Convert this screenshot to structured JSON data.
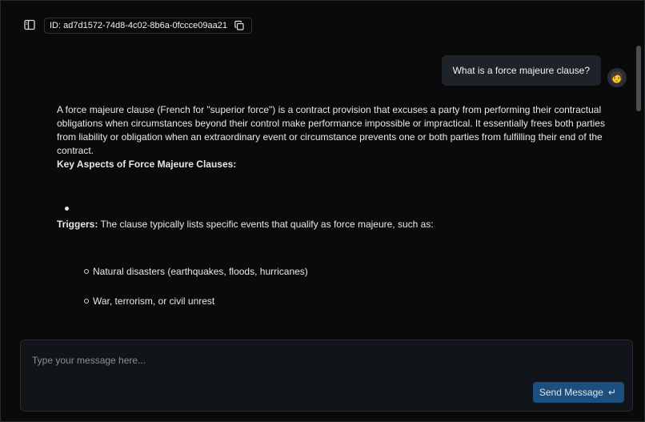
{
  "header": {
    "chat_id_label": "ID: ad7d1572-74d8-4c02-8b6a-0fccce09aa21",
    "sidebar_icon": "sidebar-toggle-icon",
    "copy_icon": "copy-icon"
  },
  "conversation": {
    "user_message": "What is a force majeure clause?",
    "user_avatar": "🧑",
    "assistant": {
      "intro": "A force majeure clause (French for \"superior force\") is a contract provision that excuses a party from performing their contractual obligations when circumstances beyond their control make performance impossible or impractical. It essentially frees both parties from liability or obligation when an extraordinary event or circumstance prevents one or both parties from fulfilling their end of the contract.",
      "heading": "Key Aspects of Force Majeure Clauses:",
      "trigger_label": "Triggers:",
      "trigger_text": " The clause typically lists specific events that qualify as force majeure, such as:",
      "sub_items": [
        "Natural disasters (earthquakes, floods, hurricanes)",
        "War, terrorism, or civil unrest"
      ]
    }
  },
  "composer": {
    "placeholder": "Type your message here...",
    "send_label": "Send Message",
    "send_icon": "enter-icon"
  },
  "colors": {
    "background": "#0a0a0b",
    "bubble": "#1e2229",
    "send_button": "#1c4f7d"
  }
}
